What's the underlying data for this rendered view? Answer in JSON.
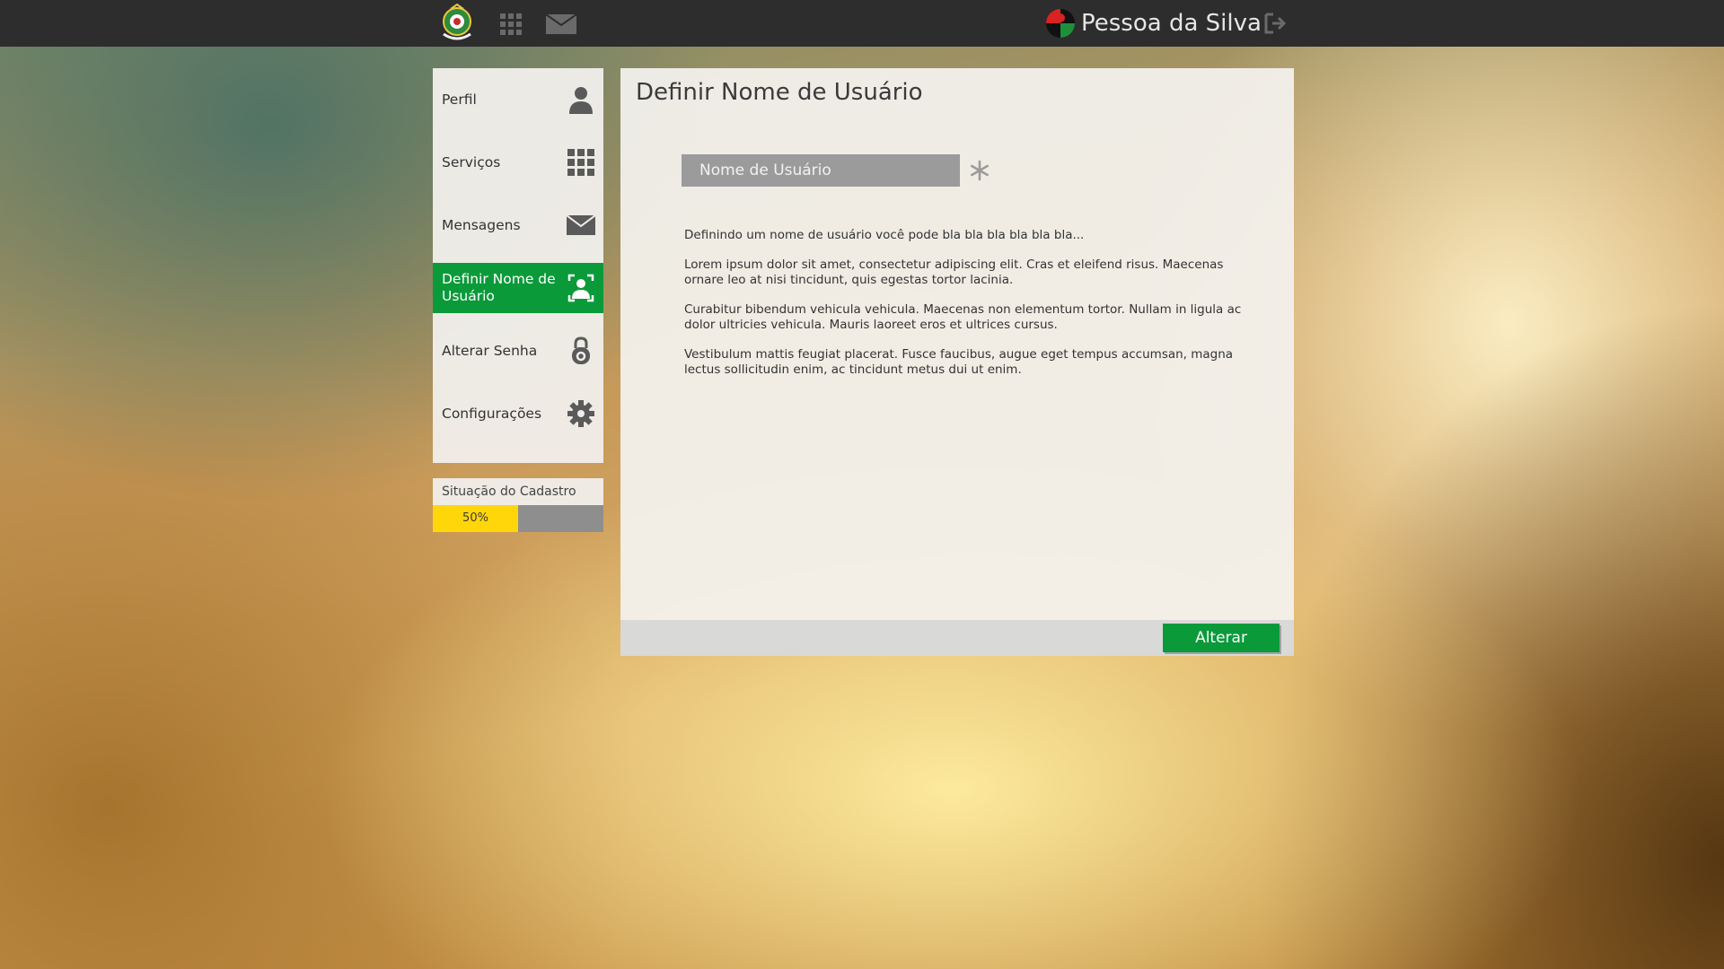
{
  "topbar": {
    "user_name": "Pessoa da Silva",
    "icons": [
      "crest-logo-icon",
      "apps-grid-icon",
      "mail-icon",
      "user-avatar-icon",
      "logout-icon"
    ]
  },
  "sidebar": {
    "items": [
      {
        "label": "Perfil",
        "icon": "user-icon"
      },
      {
        "label": "Serviços",
        "icon": "grid-icon"
      },
      {
        "label": "Mensagens",
        "icon": "envelope-icon"
      },
      {
        "label": "Definir Nome de Usuário",
        "icon": "user-frame-icon",
        "active": true
      },
      {
        "label": "Alterar Senha",
        "icon": "padlock-icon"
      },
      {
        "label": "Configurações",
        "icon": "gear-icon"
      }
    ],
    "status": {
      "title": "Situação do Cadastro",
      "progress_label": "50%",
      "progress": 0.5
    }
  },
  "main": {
    "title": "Definir Nome de Usuário",
    "username_placeholder": "Nome de Usuário",
    "paragraphs": [
      "Definindo um nome de usuário você pode bla bla bla bla bla bla...",
      "Lorem ipsum dolor sit amet, consectetur adipiscing elit. Cras et eleifend risus. Maecenas ornare leo at nisi tincidunt, quis egestas tortor lacinia.",
      "Curabitur bibendum vehicula vehicula. Maecenas non elementum tortor. Nullam in ligula ac dolor ultricies vehicula. Mauris laoreet eros et ultrices cursus.",
      "Vestibulum mattis feugiat placerat. Fusce faucibus, augue eget tempus accumsan, magna lectus sollicitudin enim, ac tincidunt metus dui ut enim."
    ],
    "submit_label": "Alterar"
  },
  "colors": {
    "accent_green": "#0b9a3a",
    "progress_yellow": "#ffd60a",
    "topbar_bg": "#2d2d2d"
  }
}
